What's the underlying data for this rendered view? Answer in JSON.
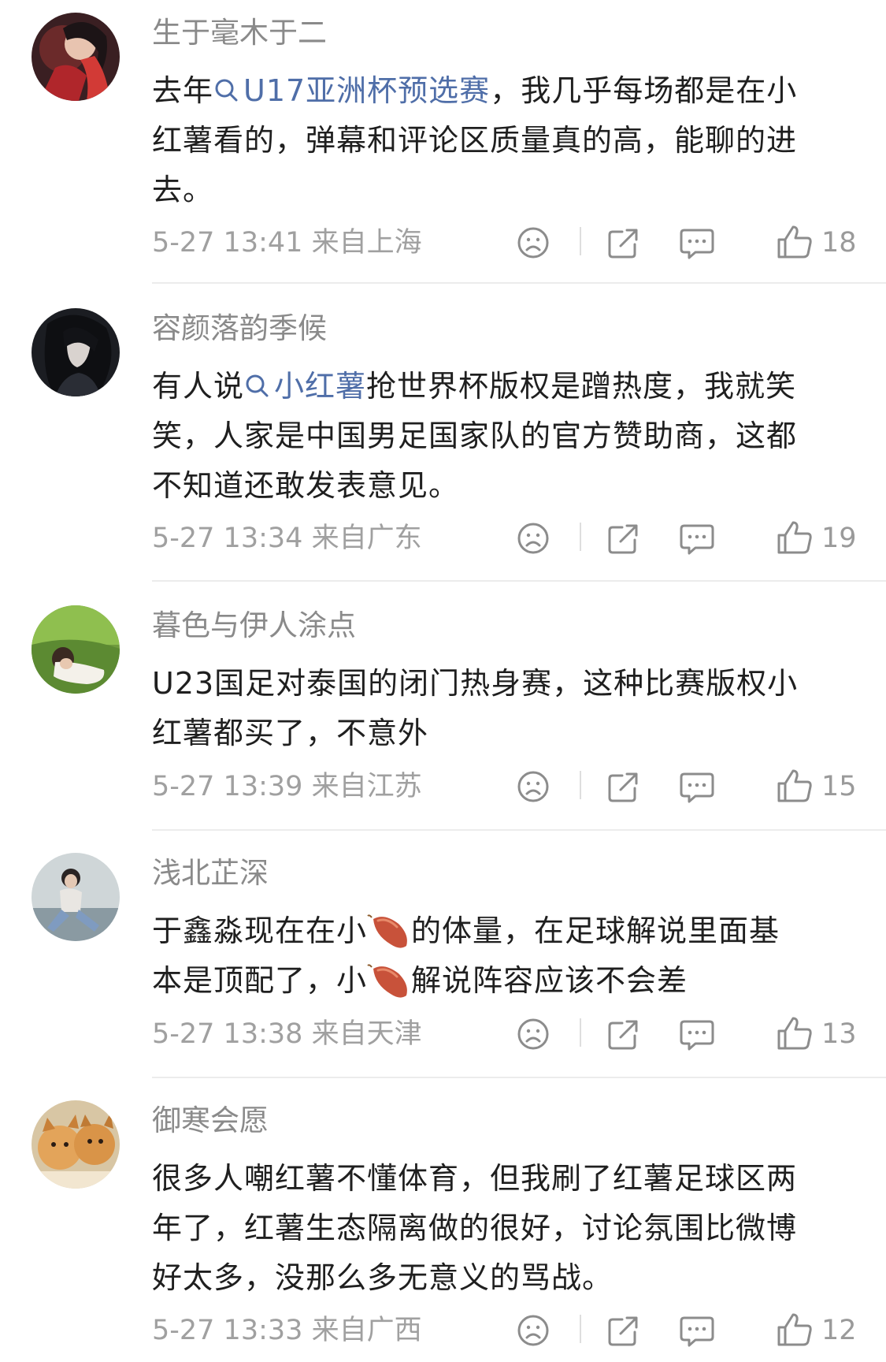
{
  "comments": [
    {
      "username": "生于毫木于二",
      "lines": [
        {
          "before": "去年",
          "link": "U17亚洲杯预选赛",
          "after": "，我几乎每场都是在小"
        },
        {
          "text": "红薯看的，弹幕和评论区质量真的高，能聊的进"
        },
        {
          "text": "去。"
        }
      ],
      "time": "5-27 13:41",
      "location": "来自上海",
      "likes": "18"
    },
    {
      "username": "容颜落韵季候",
      "lines": [
        {
          "before": "有人说",
          "link": "小红薯",
          "after": "抢世界杯版权是蹭热度，我就笑"
        },
        {
          "text": "笑，人家是中国男足国家队的官方赞助商，这都"
        },
        {
          "text": "不知道还敢发表意见。"
        }
      ],
      "time": "5-27 13:34",
      "location": "来自广东",
      "likes": "19"
    },
    {
      "username": "暮色与伊人涂点",
      "lines": [
        {
          "text": "U23国足对泰国的闭门热身赛，这种比赛版权小"
        },
        {
          "text": "红薯都买了，不意外"
        }
      ],
      "time": "5-27 13:39",
      "location": "来自江苏",
      "likes": "15"
    },
    {
      "username": "浅北芷深",
      "lines": [
        {
          "a": "于鑫淼现在在小",
          "b": "的体量，在足球解说里面基"
        },
        {
          "a": "本是顶配了，小",
          "b": "解说阵容应该不会差"
        }
      ],
      "time": "5-27 13:38",
      "location": "来自天津",
      "likes": "13"
    },
    {
      "username": "御寒会愿",
      "lines": [
        {
          "text": "很多人嘲红薯不懂体育，但我刷了红薯足球区两"
        },
        {
          "text": "年了，红薯生态隔离做的很好，讨论氛围比微博"
        },
        {
          "text": "好太多，没那么多无意义的骂战。"
        }
      ],
      "time": "5-27 13:33",
      "location": "来自广西",
      "likes": "12"
    }
  ],
  "icons": {
    "dislike": "frown-face-icon",
    "share": "share-icon",
    "reply": "comment-bubble-icon",
    "like": "thumbs-up-icon",
    "search": "search-icon",
    "emoji": "sweet-potato-emoji"
  },
  "colors": {
    "link": "#4f6ea8",
    "meta": "#a0a0a0",
    "username": "#8a8a8a",
    "icon": "#8c8c8c"
  }
}
